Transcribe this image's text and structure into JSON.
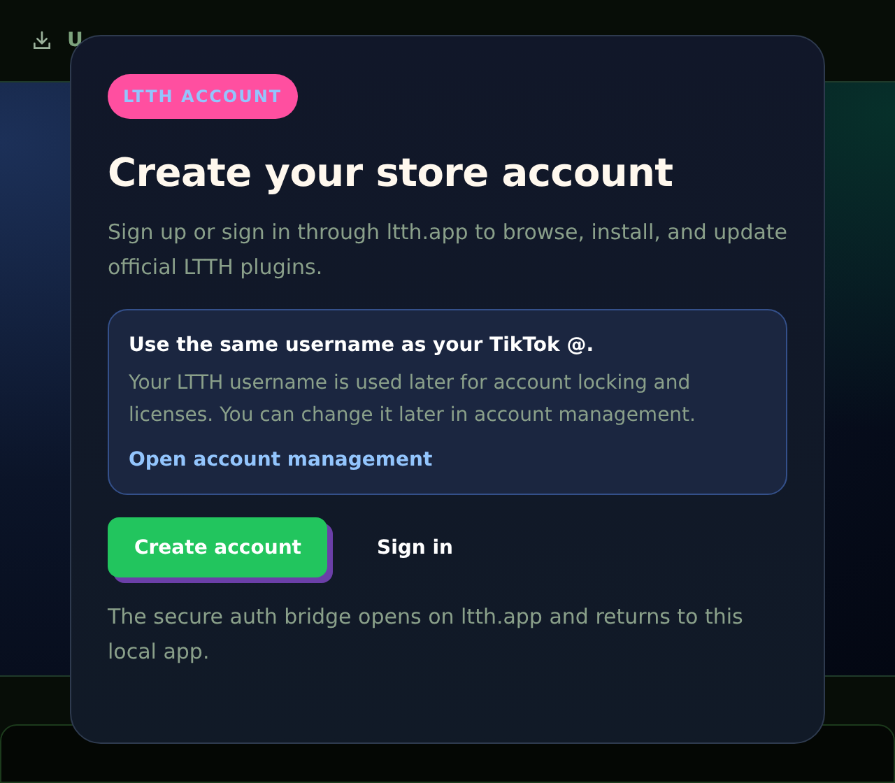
{
  "background": {
    "nav_item": {
      "label": "U"
    }
  },
  "modal": {
    "badge": "LTTH ACCOUNT",
    "title": "Create your store account",
    "intro": "Sign up or sign in through ltth.app to browse, install, and update official LTTH plugins.",
    "notice": {
      "heading": "Use the same username as your TikTok @.",
      "body": "Your LTTH username is used later for account locking and licenses. You can change it later in account management.",
      "link": "Open account management"
    },
    "buttons": [
      {
        "label": "Create account",
        "kind": "primary"
      },
      {
        "label": "Sign in",
        "kind": "ghost"
      }
    ],
    "footnote": "The secure auth bridge opens on ltth.app and returns to this local app."
  }
}
